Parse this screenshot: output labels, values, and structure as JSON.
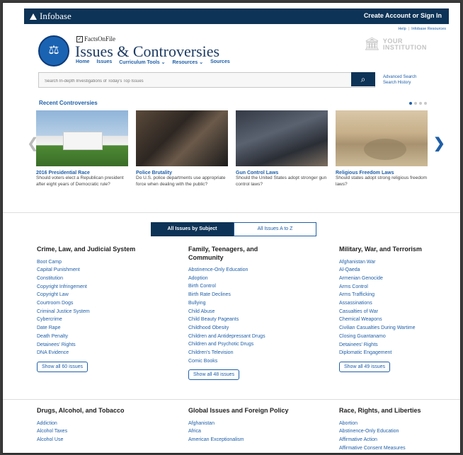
{
  "header": {
    "brand": "Infobase",
    "signin": "Create Account or Sign In"
  },
  "toplinks": {
    "help": "Help",
    "resources": "Infobase Resources"
  },
  "logo": {
    "publisher": "FactsOnFile",
    "title": "Issues & Controversies"
  },
  "nav": [
    "Home",
    "Issues",
    "Curriculum Tools ⌄",
    "Resources ⌄",
    "Sources"
  ],
  "institution": {
    "line1": "YOUR",
    "line2": "INSTITUTION"
  },
  "search": {
    "placeholder": "Search In-depth Investigations of Today's Top Issues",
    "advanced": "Advanced Search",
    "history": "Search History"
  },
  "recent": {
    "title": "Recent Controversies",
    "cards": [
      {
        "headline": "2016 Presidential Race",
        "desc": "Should voters elect a Republican president after eight years of Democratic rule?"
      },
      {
        "headline": "Police Brutality",
        "desc": "Do U.S. police departments use appropriate force when dealing with the public?"
      },
      {
        "headline": "Gun Control Laws",
        "desc": "Should the United States adopt stronger gun control laws?"
      },
      {
        "headline": "Religious Freedom Laws",
        "desc": "Should states adopt strong religious freedom laws?"
      }
    ]
  },
  "tabs": {
    "subject": "All Issues by Subject",
    "az": "All Issues A to Z"
  },
  "columns": [
    {
      "title": "Crime, Law, and Judicial System",
      "items": [
        "Boot Camp",
        "Capital Punishment",
        "Constitution",
        "Copyright Infringement",
        "Copyright Law",
        "Courtroom Dogs",
        "Criminal Justice System",
        "Cybercrime",
        "Date Rape",
        "Death Penalty",
        "Detainees' Rights",
        "DNA Evidence"
      ],
      "showall": "Show all 60 issues"
    },
    {
      "title": "Family, Teenagers, and Community",
      "items": [
        "Abstinence-Only Education",
        "Adoption",
        "Birth Control",
        "Birth Rate Declines",
        "Bullying",
        "Child Abuse",
        "Child Beauty Pageants",
        "Childhood Obesity",
        "Children and Antidepressant Drugs",
        "Children and Psychotic Drugs",
        "Children's Television",
        "Comic Books"
      ],
      "showall": "Show all 48 issues"
    },
    {
      "title": "Military, War, and Terrorism",
      "items": [
        "Afghanistan War",
        "Al-Qaeda",
        "Armenian Genocide",
        "Arms Control",
        "Arms Trafficking",
        "Assassinations",
        "Casualties of War",
        "Chemical Weapons",
        "Civilian Casualties During Wartime",
        "Closing Guantanamo",
        "Detainees' Rights",
        "Diplomatic Engagement"
      ],
      "showall": "Show all 49 issues"
    },
    {
      "title": "Drugs, Alcohol, and Tobacco",
      "items": [
        "Addiction",
        "Alcohol Taxes",
        "Alcohol Use"
      ]
    },
    {
      "title": "Global Issues and Foreign Policy",
      "items": [
        "Afghanistan",
        "Africa",
        "American Exceptionalism"
      ]
    },
    {
      "title": "Race, Rights, and Liberties",
      "items": [
        "Abortion",
        "Abstinence-Only Education",
        "Affirmative Action",
        "Affirmative Consent Measures"
      ]
    }
  ]
}
